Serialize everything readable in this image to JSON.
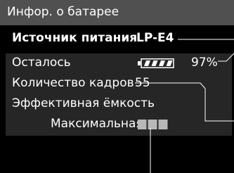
{
  "screen": {
    "title": "Инфор. о батарее",
    "source": {
      "label": "Источник питания",
      "value": "LP-E4"
    },
    "remaining": {
      "label": "Осталось",
      "percent_text": "97%",
      "level": 0.97
    },
    "shots": {
      "label": "Количество кадров",
      "value": "55"
    },
    "capacity": {
      "label": "Эффективная ёмкость",
      "max_label": "Максимальная",
      "bars_filled": 3,
      "bars_total": 3
    }
  },
  "colors": {
    "background": "#000000",
    "title_bar": "#505050",
    "panel": "#262626",
    "text": "#ffffff",
    "capacity_bar": "#b8b8b8"
  },
  "icons": {
    "battery": "battery-icon",
    "capacity": "capacity-bars-icon"
  }
}
